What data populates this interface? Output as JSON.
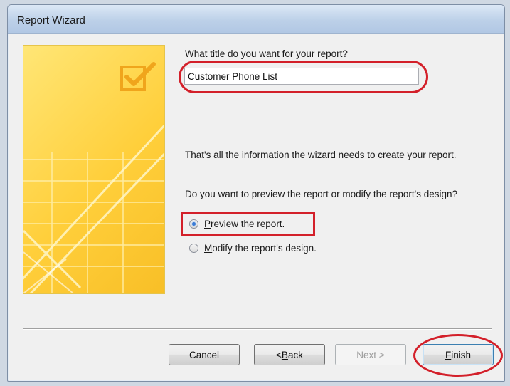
{
  "window": {
    "title": "Report Wizard"
  },
  "question_title": "What title do you want for your report?",
  "report_title_value": "Customer Phone List",
  "info_text": "That's all the information the wizard needs to create your report.",
  "preview_question": "Do you want to preview the report or modify the report's design?",
  "options": [
    {
      "label_first": "P",
      "label_rest": "review the report.",
      "selected": true
    },
    {
      "label_first": "M",
      "label_rest": "odify the report's design.",
      "selected": false
    }
  ],
  "buttons": {
    "cancel": "Cancel",
    "back_prefix": "< ",
    "back_u": "B",
    "back_rest": "ack",
    "next": "Next >",
    "finish_u": "F",
    "finish_rest": "inish"
  },
  "colors": {
    "annotation_red": "#d3202a",
    "wizard_art_yellow": "#ffd84a"
  },
  "icons": [
    "checkbox-check-icon",
    "radio-button"
  ]
}
